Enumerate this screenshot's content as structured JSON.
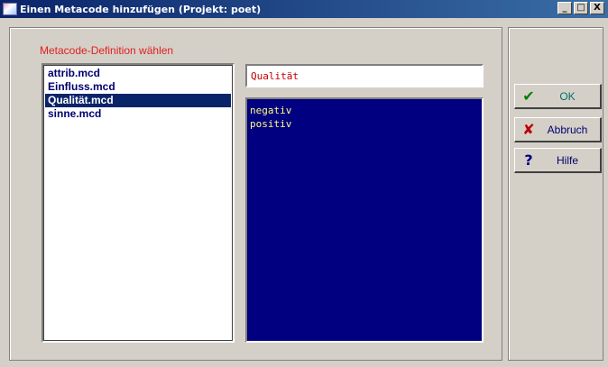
{
  "window": {
    "title": "Einen Metacode hinzufügen (Projekt: poet)",
    "minimize_glyph": "_",
    "maximize_glyph": "□",
    "close_glyph": "X"
  },
  "section_label": "Metacode-Definition wählen",
  "metacode_files": [
    {
      "name": "attrib.mcd",
      "selected": false
    },
    {
      "name": "Einfluss.mcd",
      "selected": false
    },
    {
      "name": "Qualität.mcd",
      "selected": true
    },
    {
      "name": "sinne.mcd",
      "selected": false
    }
  ],
  "selected_name": "Qualität",
  "values": [
    "negativ",
    "positiv"
  ],
  "buttons": {
    "ok_label": "OK",
    "cancel_label": "Abbruch",
    "help_label": "Hilfe",
    "ok_icon": "✔",
    "cancel_icon": "✘",
    "help_icon": "?"
  },
  "colors": {
    "title_bar": "#0a246a",
    "selection": "#0a246a",
    "value_bg": "#000080",
    "value_text": "#ffff80",
    "label_red": "#e02020"
  },
  "icons": {
    "title": "app-icon",
    "ok": "checkmark-icon",
    "cancel": "cross-icon",
    "help": "question-icon"
  }
}
